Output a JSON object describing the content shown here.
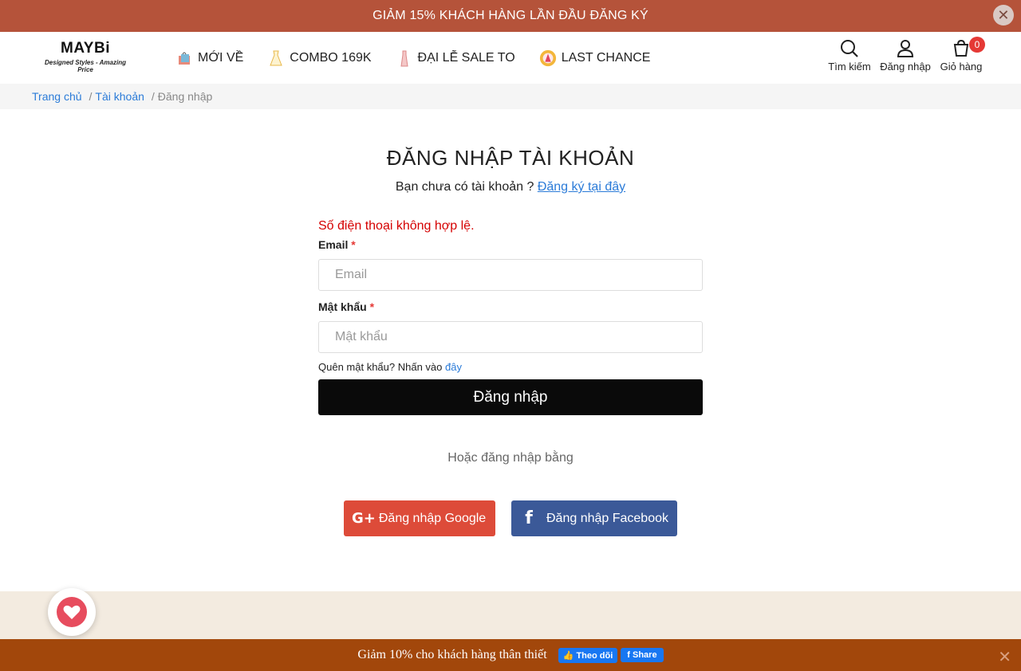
{
  "promo": {
    "text": "GIẢM 15% KHÁCH HÀNG LẦN ĐẦU ĐĂNG KÝ",
    "close_icon": "close-icon"
  },
  "logo": {
    "main": "MAYBi",
    "sub": "Designed Styles - Amazing Price"
  },
  "nav": [
    {
      "label": "MỚI VỀ",
      "icon": "shopping-bag-icon"
    },
    {
      "label": "COMBO 169K",
      "icon": "dress-icon"
    },
    {
      "label": "ĐẠI LỄ SALE TO",
      "icon": "dress-icon"
    },
    {
      "label": "LAST CHANCE",
      "icon": "badge-icon"
    }
  ],
  "header_actions": {
    "search": "Tìm kiếm",
    "login": "Đăng nhập",
    "cart": "Giỏ hàng",
    "cart_count": "0"
  },
  "breadcrumb": {
    "home": "Trang chủ",
    "account": "Tài khoản",
    "current": "Đăng nhập",
    "separator": "/"
  },
  "login": {
    "title": "ĐĂNG NHẬP TÀI KHOẢN",
    "subtitle": "Bạn chưa có tài khoản ?",
    "register_link": "Đăng ký tại đây",
    "error": "Số điện thoại không hợp lệ.",
    "email_label": "Email",
    "email_placeholder": "Email",
    "password_label": "Mật khẩu",
    "password_placeholder": "Mật khẩu",
    "required_mark": "*",
    "forgot_text": "Quên mật khẩu? Nhấn vào",
    "forgot_link": "đây",
    "submit": "Đăng nhập",
    "or_text": "Hoặc đăng nhập bằng",
    "google_button": "Đăng nhập Google",
    "facebook_button": "Đăng nhập Facebook"
  },
  "bottom_bar": {
    "text": "Giảm 10% cho khách hàng thân thiết",
    "follow": "Theo dõi",
    "share": "Share"
  },
  "colors": {
    "promo_bg": "#b5533a",
    "bottom_bg": "#a2470b",
    "google": "#dd4b39",
    "facebook": "#3b5998",
    "error": "#d50000",
    "link": "#2b7bd8"
  }
}
